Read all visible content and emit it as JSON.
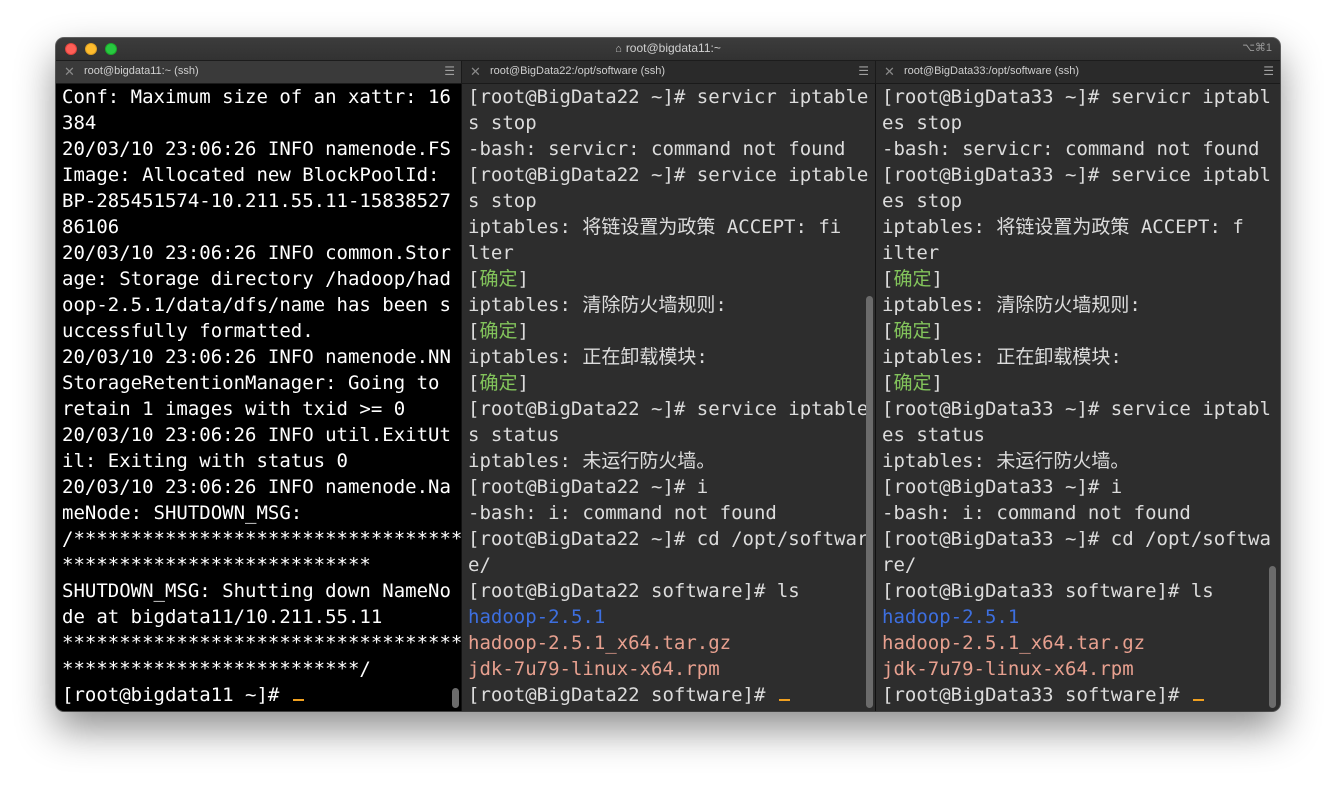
{
  "window": {
    "title": "root@bigdata11:~",
    "shortcut": "⌥⌘1"
  },
  "tabs": [
    {
      "label": "root@bigdata11:~ (ssh)"
    },
    {
      "label": "root@BigData22:/opt/software (ssh)"
    },
    {
      "label": "root@BigData33:/opt/software (ssh)"
    }
  ],
  "pane1": {
    "lines": [
      "Conf: Maximum size of an xattr: 16",
      "384",
      "20/03/10 23:06:26 INFO namenode.FS",
      "Image: Allocated new BlockPoolId:",
      "BP-285451574-10.211.55.11-15838527",
      "86106",
      "20/03/10 23:06:26 INFO common.Stor",
      "age: Storage directory /hadoop/had",
      "oop-2.5.1/data/dfs/name has been s",
      "uccessfully formatted.",
      "20/03/10 23:06:26 INFO namenode.NN",
      "StorageRetentionManager: Going to",
      "retain 1 images with txid >= 0",
      "20/03/10 23:06:26 INFO util.ExitUt",
      "il: Exiting with status 0",
      "20/03/10 23:06:26 INFO namenode.Na",
      "meNode: SHUTDOWN_MSG:",
      "/**********************************",
      "***************************",
      "SHUTDOWN_MSG: Shutting down NameNo",
      "de at bigdata11/10.211.55.11",
      "***********************************",
      "**************************/"
    ],
    "prompt": "[root@bigdata11 ~]# "
  },
  "pane2": {
    "lines": [
      "[root@BigData22 ~]# servicr iptable",
      "s stop",
      "-bash: servicr: command not found",
      "[root@BigData22 ~]# service iptable",
      "s stop",
      "iptables: 将链设置为政策 ACCEPT: fi",
      "lter"
    ],
    "ok1_open": "[",
    "ok1_text": "确定",
    "ok1_close": "]",
    "line_clear": "iptables: 清除防火墙规则:",
    "ok2_open": "[",
    "ok2_text": "确定",
    "ok2_close": "]",
    "line_unload": "iptables: 正在卸载模块:",
    "ok3_open": "[",
    "ok3_text": "确定",
    "ok3_close": "]",
    "lines_after": [
      "[root@BigData22 ~]# service iptable",
      "s status",
      "iptables: 未运行防火墙。",
      "[root@BigData22 ~]# i",
      "-bash: i: command not found",
      "[root@BigData22 ~]# cd /opt/softwar",
      "e/",
      "[root@BigData22 software]# ls"
    ],
    "ls_dir": "hadoop-2.5.1",
    "ls_file1": "hadoop-2.5.1_x64.tar.gz",
    "ls_file2": "jdk-7u79-linux-x64.rpm",
    "prompt": "[root@BigData22 software]# "
  },
  "pane3": {
    "lines": [
      "[root@BigData33 ~]# servicr iptabl",
      "es stop",
      "-bash: servicr: command not found",
      "[root@BigData33 ~]# service iptabl",
      "es stop",
      "iptables: 将链设置为政策 ACCEPT: f",
      "ilter"
    ],
    "ok1_open": "[",
    "ok1_text": "确定",
    "ok1_close": "]",
    "line_clear": "iptables: 清除防火墙规则:",
    "ok2_open": "[",
    "ok2_text": "确定",
    "ok2_close": "]",
    "line_unload": "iptables: 正在卸载模块:",
    "ok3_open": "[",
    "ok3_text": "确定",
    "ok3_close": "]",
    "lines_after": [
      "[root@BigData33 ~]# service iptabl",
      "es status",
      "iptables: 未运行防火墙。",
      "[root@BigData33 ~]# i",
      "-bash: i: command not found",
      "[root@BigData33 ~]# cd /opt/softwa",
      "re/",
      "[root@BigData33 software]# ls"
    ],
    "ls_dir": "hadoop-2.5.1",
    "ls_file1": "hadoop-2.5.1_x64.tar.gz",
    "ls_file2": "jdk-7u79-linux-x64.rpm",
    "prompt": "[root@BigData33 software]# "
  },
  "colors": {
    "ok_green": "#82c35b",
    "dir_blue": "#3d6fe0",
    "archive_salmon": "#e7a08f",
    "cursor_orange": "#f0a020"
  }
}
